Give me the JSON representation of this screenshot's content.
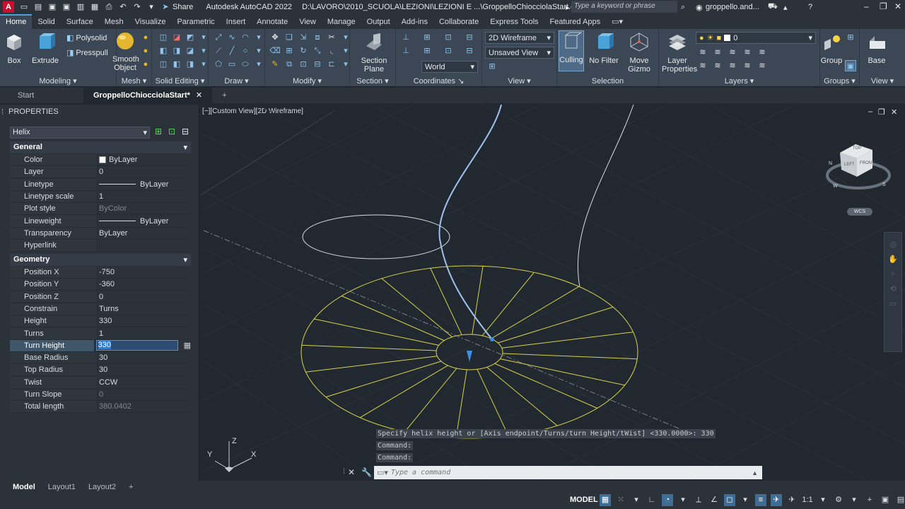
{
  "title_bar": {
    "share_label": "Share",
    "app_title": "Autodesk AutoCAD 2022",
    "file_path": "D:\\LAVORO\\2010_SCUOLA\\LEZIONI\\LEZIONI E ...\\GroppelloChiocciolaStart.dwg",
    "search_placeholder": "Type a keyword or phrase",
    "user": "groppello.and..."
  },
  "ribbon_tabs": [
    "Home",
    "Solid",
    "Surface",
    "Mesh",
    "Visualize",
    "Parametric",
    "Insert",
    "Annotate",
    "View",
    "Manage",
    "Output",
    "Add-ins",
    "Collaborate",
    "Express Tools",
    "Featured Apps"
  ],
  "ribbon": {
    "modeling": {
      "title": "Modeling",
      "box": "Box",
      "extrude": "Extrude",
      "polysolid": "Polysolid",
      "presspull": "Presspull"
    },
    "mesh": {
      "title": "Mesh",
      "smooth_object": "Smooth Object"
    },
    "solid_editing": {
      "title": "Solid Editing"
    },
    "draw": {
      "title": "Draw"
    },
    "modify": {
      "title": "Modify"
    },
    "section": {
      "title": "Section",
      "section_plane": "Section Plane"
    },
    "coordinates": {
      "title": "Coordinates",
      "world": "World"
    },
    "view": {
      "title": "View",
      "visual_style": "2D Wireframe",
      "saved_view": "Unsaved View"
    },
    "selection": {
      "title": "Selection",
      "culling": "Culling",
      "no_filter": "No Filter",
      "move_gizmo": "Move Gizmo"
    },
    "layers": {
      "title": "Layers",
      "layer_properties": "Layer Properties",
      "current_layer": "0"
    },
    "groups": {
      "title": "Groups",
      "group": "Group"
    },
    "view2": {
      "title": "View",
      "base": "Base"
    }
  },
  "doc_tabs": {
    "start": "Start",
    "active": "GroppelloChiocciolaStart*"
  },
  "properties": {
    "title": "PROPERTIES",
    "object": "Helix",
    "general_title": "General",
    "general": [
      {
        "name": "Color",
        "value": "ByLayer"
      },
      {
        "name": "Layer",
        "value": "0"
      },
      {
        "name": "Linetype",
        "value": "ByLayer"
      },
      {
        "name": "Linetype scale",
        "value": "1"
      },
      {
        "name": "Plot style",
        "value": "ByColor"
      },
      {
        "name": "Lineweight",
        "value": "ByLayer"
      },
      {
        "name": "Transparency",
        "value": "ByLayer"
      },
      {
        "name": "Hyperlink",
        "value": ""
      }
    ],
    "geometry_title": "Geometry",
    "geometry": [
      {
        "name": "Position X",
        "value": "-750"
      },
      {
        "name": "Position Y",
        "value": "-360"
      },
      {
        "name": "Position Z",
        "value": "0"
      },
      {
        "name": "Constrain",
        "value": "Turns"
      },
      {
        "name": "Height",
        "value": "330"
      },
      {
        "name": "Turns",
        "value": "1"
      },
      {
        "name": "Turn Height",
        "value": "330"
      },
      {
        "name": "Base Radius",
        "value": "30"
      },
      {
        "name": "Top Radius",
        "value": "30"
      },
      {
        "name": "Twist",
        "value": "CCW"
      },
      {
        "name": "Turn Slope",
        "value": "0"
      },
      {
        "name": "Total length",
        "value": "380.0402"
      }
    ]
  },
  "viewport": {
    "label": "[−][Custom View][2D Wireframe]",
    "viewcube": {
      "top": "TOP",
      "left": "LEFT",
      "front": "FRONT",
      "n": "N",
      "w": "W",
      "s": "S"
    },
    "wcs": "WCS",
    "ucs": {
      "x": "X",
      "y": "Y",
      "z": "Z"
    }
  },
  "command": {
    "history": [
      "Specify helix height or [Axis endpoint/Turns/turn Height/tWist] <330.0000>: 330",
      "Command:",
      "Command:"
    ],
    "placeholder": "Type a command"
  },
  "layout_tabs": [
    "Model",
    "Layout1",
    "Layout2"
  ],
  "status": {
    "model": "MODEL",
    "scale": "1:1"
  }
}
